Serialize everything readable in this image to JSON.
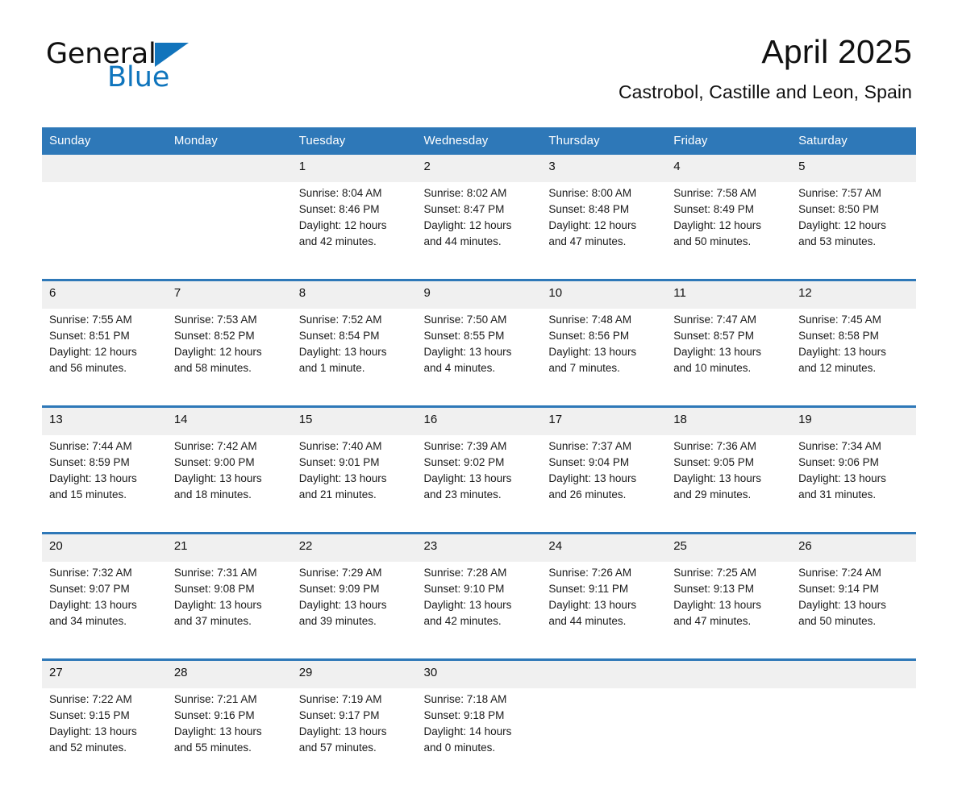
{
  "brand": {
    "name_part1": "General",
    "name_part2": "Blue",
    "triangle_icon": "triangle-icon",
    "accent_color": "#0f75bd"
  },
  "header": {
    "title": "April 2025",
    "subtitle": "Castrobol, Castille and Leon, Spain"
  },
  "theme": {
    "header_blue": "#2e78b8",
    "date_band_gray": "#f0f0f0",
    "text_black": "#111111"
  },
  "weekdays": [
    "Sunday",
    "Monday",
    "Tuesday",
    "Wednesday",
    "Thursday",
    "Friday",
    "Saturday"
  ],
  "weeks": [
    {
      "dates": [
        "",
        "",
        "1",
        "2",
        "3",
        "4",
        "5"
      ],
      "cells": [
        {
          "sunrise": "",
          "sunset": "",
          "daylight_line1": "",
          "daylight_line2": ""
        },
        {
          "sunrise": "",
          "sunset": "",
          "daylight_line1": "",
          "daylight_line2": ""
        },
        {
          "sunrise": "Sunrise: 8:04 AM",
          "sunset": "Sunset: 8:46 PM",
          "daylight_line1": "Daylight: 12 hours",
          "daylight_line2": "and 42 minutes."
        },
        {
          "sunrise": "Sunrise: 8:02 AM",
          "sunset": "Sunset: 8:47 PM",
          "daylight_line1": "Daylight: 12 hours",
          "daylight_line2": "and 44 minutes."
        },
        {
          "sunrise": "Sunrise: 8:00 AM",
          "sunset": "Sunset: 8:48 PM",
          "daylight_line1": "Daylight: 12 hours",
          "daylight_line2": "and 47 minutes."
        },
        {
          "sunrise": "Sunrise: 7:58 AM",
          "sunset": "Sunset: 8:49 PM",
          "daylight_line1": "Daylight: 12 hours",
          "daylight_line2": "and 50 minutes."
        },
        {
          "sunrise": "Sunrise: 7:57 AM",
          "sunset": "Sunset: 8:50 PM",
          "daylight_line1": "Daylight: 12 hours",
          "daylight_line2": "and 53 minutes."
        }
      ]
    },
    {
      "dates": [
        "6",
        "7",
        "8",
        "9",
        "10",
        "11",
        "12"
      ],
      "cells": [
        {
          "sunrise": "Sunrise: 7:55 AM",
          "sunset": "Sunset: 8:51 PM",
          "daylight_line1": "Daylight: 12 hours",
          "daylight_line2": "and 56 minutes."
        },
        {
          "sunrise": "Sunrise: 7:53 AM",
          "sunset": "Sunset: 8:52 PM",
          "daylight_line1": "Daylight: 12 hours",
          "daylight_line2": "and 58 minutes."
        },
        {
          "sunrise": "Sunrise: 7:52 AM",
          "sunset": "Sunset: 8:54 PM",
          "daylight_line1": "Daylight: 13 hours",
          "daylight_line2": "and 1 minute."
        },
        {
          "sunrise": "Sunrise: 7:50 AM",
          "sunset": "Sunset: 8:55 PM",
          "daylight_line1": "Daylight: 13 hours",
          "daylight_line2": "and 4 minutes."
        },
        {
          "sunrise": "Sunrise: 7:48 AM",
          "sunset": "Sunset: 8:56 PM",
          "daylight_line1": "Daylight: 13 hours",
          "daylight_line2": "and 7 minutes."
        },
        {
          "sunrise": "Sunrise: 7:47 AM",
          "sunset": "Sunset: 8:57 PM",
          "daylight_line1": "Daylight: 13 hours",
          "daylight_line2": "and 10 minutes."
        },
        {
          "sunrise": "Sunrise: 7:45 AM",
          "sunset": "Sunset: 8:58 PM",
          "daylight_line1": "Daylight: 13 hours",
          "daylight_line2": "and 12 minutes."
        }
      ]
    },
    {
      "dates": [
        "13",
        "14",
        "15",
        "16",
        "17",
        "18",
        "19"
      ],
      "cells": [
        {
          "sunrise": "Sunrise: 7:44 AM",
          "sunset": "Sunset: 8:59 PM",
          "daylight_line1": "Daylight: 13 hours",
          "daylight_line2": "and 15 minutes."
        },
        {
          "sunrise": "Sunrise: 7:42 AM",
          "sunset": "Sunset: 9:00 PM",
          "daylight_line1": "Daylight: 13 hours",
          "daylight_line2": "and 18 minutes."
        },
        {
          "sunrise": "Sunrise: 7:40 AM",
          "sunset": "Sunset: 9:01 PM",
          "daylight_line1": "Daylight: 13 hours",
          "daylight_line2": "and 21 minutes."
        },
        {
          "sunrise": "Sunrise: 7:39 AM",
          "sunset": "Sunset: 9:02 PM",
          "daylight_line1": "Daylight: 13 hours",
          "daylight_line2": "and 23 minutes."
        },
        {
          "sunrise": "Sunrise: 7:37 AM",
          "sunset": "Sunset: 9:04 PM",
          "daylight_line1": "Daylight: 13 hours",
          "daylight_line2": "and 26 minutes."
        },
        {
          "sunrise": "Sunrise: 7:36 AM",
          "sunset": "Sunset: 9:05 PM",
          "daylight_line1": "Daylight: 13 hours",
          "daylight_line2": "and 29 minutes."
        },
        {
          "sunrise": "Sunrise: 7:34 AM",
          "sunset": "Sunset: 9:06 PM",
          "daylight_line1": "Daylight: 13 hours",
          "daylight_line2": "and 31 minutes."
        }
      ]
    },
    {
      "dates": [
        "20",
        "21",
        "22",
        "23",
        "24",
        "25",
        "26"
      ],
      "cells": [
        {
          "sunrise": "Sunrise: 7:32 AM",
          "sunset": "Sunset: 9:07 PM",
          "daylight_line1": "Daylight: 13 hours",
          "daylight_line2": "and 34 minutes."
        },
        {
          "sunrise": "Sunrise: 7:31 AM",
          "sunset": "Sunset: 9:08 PM",
          "daylight_line1": "Daylight: 13 hours",
          "daylight_line2": "and 37 minutes."
        },
        {
          "sunrise": "Sunrise: 7:29 AM",
          "sunset": "Sunset: 9:09 PM",
          "daylight_line1": "Daylight: 13 hours",
          "daylight_line2": "and 39 minutes."
        },
        {
          "sunrise": "Sunrise: 7:28 AM",
          "sunset": "Sunset: 9:10 PM",
          "daylight_line1": "Daylight: 13 hours",
          "daylight_line2": "and 42 minutes."
        },
        {
          "sunrise": "Sunrise: 7:26 AM",
          "sunset": "Sunset: 9:11 PM",
          "daylight_line1": "Daylight: 13 hours",
          "daylight_line2": "and 44 minutes."
        },
        {
          "sunrise": "Sunrise: 7:25 AM",
          "sunset": "Sunset: 9:13 PM",
          "daylight_line1": "Daylight: 13 hours",
          "daylight_line2": "and 47 minutes."
        },
        {
          "sunrise": "Sunrise: 7:24 AM",
          "sunset": "Sunset: 9:14 PM",
          "daylight_line1": "Daylight: 13 hours",
          "daylight_line2": "and 50 minutes."
        }
      ]
    },
    {
      "dates": [
        "27",
        "28",
        "29",
        "30",
        "",
        "",
        ""
      ],
      "cells": [
        {
          "sunrise": "Sunrise: 7:22 AM",
          "sunset": "Sunset: 9:15 PM",
          "daylight_line1": "Daylight: 13 hours",
          "daylight_line2": "and 52 minutes."
        },
        {
          "sunrise": "Sunrise: 7:21 AM",
          "sunset": "Sunset: 9:16 PM",
          "daylight_line1": "Daylight: 13 hours",
          "daylight_line2": "and 55 minutes."
        },
        {
          "sunrise": "Sunrise: 7:19 AM",
          "sunset": "Sunset: 9:17 PM",
          "daylight_line1": "Daylight: 13 hours",
          "daylight_line2": "and 57 minutes."
        },
        {
          "sunrise": "Sunrise: 7:18 AM",
          "sunset": "Sunset: 9:18 PM",
          "daylight_line1": "Daylight: 14 hours",
          "daylight_line2": "and 0 minutes."
        },
        {
          "sunrise": "",
          "sunset": "",
          "daylight_line1": "",
          "daylight_line2": ""
        },
        {
          "sunrise": "",
          "sunset": "",
          "daylight_line1": "",
          "daylight_line2": ""
        },
        {
          "sunrise": "",
          "sunset": "",
          "daylight_line1": "",
          "daylight_line2": ""
        }
      ]
    }
  ]
}
